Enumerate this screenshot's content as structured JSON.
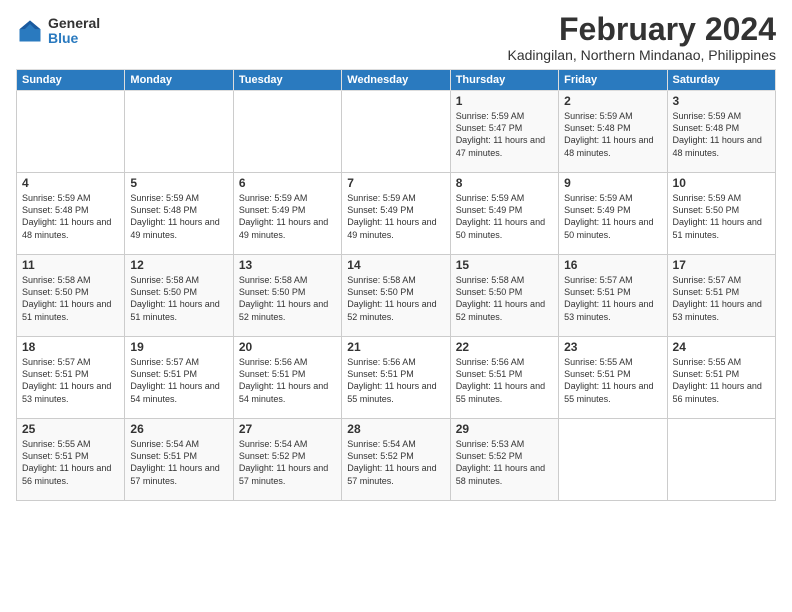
{
  "logo": {
    "general": "General",
    "blue": "Blue"
  },
  "title": "February 2024",
  "subtitle": "Kadingilan, Northern Mindanao, Philippines",
  "headers": [
    "Sunday",
    "Monday",
    "Tuesday",
    "Wednesday",
    "Thursday",
    "Friday",
    "Saturday"
  ],
  "weeks": [
    [
      {
        "day": "",
        "info": ""
      },
      {
        "day": "",
        "info": ""
      },
      {
        "day": "",
        "info": ""
      },
      {
        "day": "",
        "info": ""
      },
      {
        "day": "1",
        "info": "Sunrise: 5:59 AM\nSunset: 5:47 PM\nDaylight: 11 hours and 47 minutes."
      },
      {
        "day": "2",
        "info": "Sunrise: 5:59 AM\nSunset: 5:48 PM\nDaylight: 11 hours and 48 minutes."
      },
      {
        "day": "3",
        "info": "Sunrise: 5:59 AM\nSunset: 5:48 PM\nDaylight: 11 hours and 48 minutes."
      }
    ],
    [
      {
        "day": "4",
        "info": "Sunrise: 5:59 AM\nSunset: 5:48 PM\nDaylight: 11 hours and 48 minutes."
      },
      {
        "day": "5",
        "info": "Sunrise: 5:59 AM\nSunset: 5:48 PM\nDaylight: 11 hours and 49 minutes."
      },
      {
        "day": "6",
        "info": "Sunrise: 5:59 AM\nSunset: 5:49 PM\nDaylight: 11 hours and 49 minutes."
      },
      {
        "day": "7",
        "info": "Sunrise: 5:59 AM\nSunset: 5:49 PM\nDaylight: 11 hours and 49 minutes."
      },
      {
        "day": "8",
        "info": "Sunrise: 5:59 AM\nSunset: 5:49 PM\nDaylight: 11 hours and 50 minutes."
      },
      {
        "day": "9",
        "info": "Sunrise: 5:59 AM\nSunset: 5:49 PM\nDaylight: 11 hours and 50 minutes."
      },
      {
        "day": "10",
        "info": "Sunrise: 5:59 AM\nSunset: 5:50 PM\nDaylight: 11 hours and 51 minutes."
      }
    ],
    [
      {
        "day": "11",
        "info": "Sunrise: 5:58 AM\nSunset: 5:50 PM\nDaylight: 11 hours and 51 minutes."
      },
      {
        "day": "12",
        "info": "Sunrise: 5:58 AM\nSunset: 5:50 PM\nDaylight: 11 hours and 51 minutes."
      },
      {
        "day": "13",
        "info": "Sunrise: 5:58 AM\nSunset: 5:50 PM\nDaylight: 11 hours and 52 minutes."
      },
      {
        "day": "14",
        "info": "Sunrise: 5:58 AM\nSunset: 5:50 PM\nDaylight: 11 hours and 52 minutes."
      },
      {
        "day": "15",
        "info": "Sunrise: 5:58 AM\nSunset: 5:50 PM\nDaylight: 11 hours and 52 minutes."
      },
      {
        "day": "16",
        "info": "Sunrise: 5:57 AM\nSunset: 5:51 PM\nDaylight: 11 hours and 53 minutes."
      },
      {
        "day": "17",
        "info": "Sunrise: 5:57 AM\nSunset: 5:51 PM\nDaylight: 11 hours and 53 minutes."
      }
    ],
    [
      {
        "day": "18",
        "info": "Sunrise: 5:57 AM\nSunset: 5:51 PM\nDaylight: 11 hours and 53 minutes."
      },
      {
        "day": "19",
        "info": "Sunrise: 5:57 AM\nSunset: 5:51 PM\nDaylight: 11 hours and 54 minutes."
      },
      {
        "day": "20",
        "info": "Sunrise: 5:56 AM\nSunset: 5:51 PM\nDaylight: 11 hours and 54 minutes."
      },
      {
        "day": "21",
        "info": "Sunrise: 5:56 AM\nSunset: 5:51 PM\nDaylight: 11 hours and 55 minutes."
      },
      {
        "day": "22",
        "info": "Sunrise: 5:56 AM\nSunset: 5:51 PM\nDaylight: 11 hours and 55 minutes."
      },
      {
        "day": "23",
        "info": "Sunrise: 5:55 AM\nSunset: 5:51 PM\nDaylight: 11 hours and 55 minutes."
      },
      {
        "day": "24",
        "info": "Sunrise: 5:55 AM\nSunset: 5:51 PM\nDaylight: 11 hours and 56 minutes."
      }
    ],
    [
      {
        "day": "25",
        "info": "Sunrise: 5:55 AM\nSunset: 5:51 PM\nDaylight: 11 hours and 56 minutes."
      },
      {
        "day": "26",
        "info": "Sunrise: 5:54 AM\nSunset: 5:51 PM\nDaylight: 11 hours and 57 minutes."
      },
      {
        "day": "27",
        "info": "Sunrise: 5:54 AM\nSunset: 5:52 PM\nDaylight: 11 hours and 57 minutes."
      },
      {
        "day": "28",
        "info": "Sunrise: 5:54 AM\nSunset: 5:52 PM\nDaylight: 11 hours and 57 minutes."
      },
      {
        "day": "29",
        "info": "Sunrise: 5:53 AM\nSunset: 5:52 PM\nDaylight: 11 hours and 58 minutes."
      },
      {
        "day": "",
        "info": ""
      },
      {
        "day": "",
        "info": ""
      }
    ]
  ]
}
